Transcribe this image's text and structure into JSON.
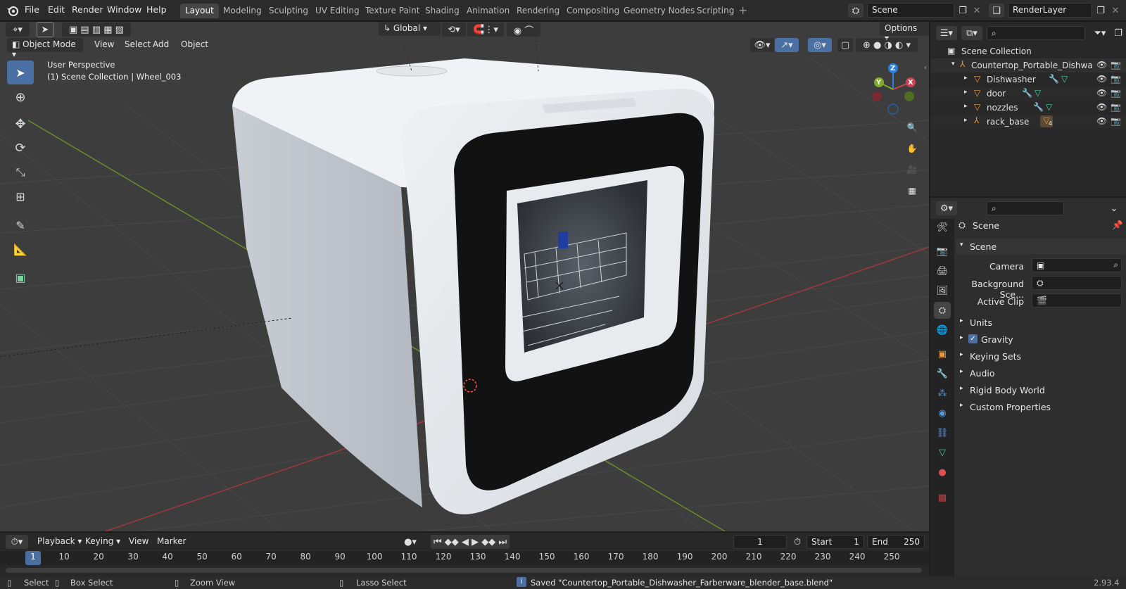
{
  "menu": [
    "File",
    "Edit",
    "Render",
    "Window",
    "Help"
  ],
  "workspaces": [
    "Layout",
    "Modeling",
    "Sculpting",
    "UV Editing",
    "Texture Paint",
    "Shading",
    "Animation",
    "Rendering",
    "Compositing",
    "Geometry Nodes",
    "Scripting"
  ],
  "active_workspace": "Layout",
  "scene_name": "Scene",
  "view_layer": "RenderLayer",
  "viewport": {
    "mode": "Object Mode",
    "menus": [
      "View",
      "Select",
      "Add",
      "Object"
    ],
    "transform_orientation": "Global",
    "options_label": "Options",
    "info_line1": "User Perspective",
    "info_line2": "(1) Scene Collection | Wheel_003",
    "gizmo_labels": {
      "x": "X",
      "y": "Y",
      "z": "Z"
    }
  },
  "outliner": {
    "root": "Scene Collection",
    "parent": "Countertop_Portable_Dishwa",
    "children": [
      "Dishwasher",
      "door",
      "nozzles",
      "rack_base"
    ],
    "rack_base_badge": "4"
  },
  "properties": {
    "header": "Scene",
    "panel": "Scene",
    "camera_label": "Camera",
    "bg_scene_label": "Background Sce...",
    "active_clip_label": "Active Clip",
    "gravity_checked": true,
    "sections": [
      "Units",
      "Gravity",
      "Keying Sets",
      "Audio",
      "Rigid Body World",
      "Custom Properties"
    ]
  },
  "timeline": {
    "menus": [
      "Playback",
      "Keying",
      "View",
      "Marker"
    ],
    "current_frame": "1",
    "start_label": "Start",
    "start_value": "1",
    "end_label": "End",
    "end_value": "250",
    "ticks": [
      "1",
      "10",
      "20",
      "30",
      "40",
      "50",
      "60",
      "70",
      "80",
      "90",
      "100",
      "110",
      "120",
      "130",
      "140",
      "150",
      "160",
      "170",
      "180",
      "190",
      "200",
      "210",
      "220",
      "230",
      "240",
      "250"
    ]
  },
  "status": {
    "select": "Select",
    "box_select": "Box Select",
    "zoom_view": "Zoom View",
    "lasso_select": "Lasso Select",
    "message": "Saved \"Countertop_Portable_Dishwasher_Farberware_blender_base.blend\"",
    "version": "2.93.4"
  },
  "colors": {
    "accent": "#4a6fa3",
    "x_axis": "#c8434f",
    "y_axis": "#7fad2b",
    "z_axis": "#2a7fe0",
    "object_orange": "#e89a3c"
  }
}
